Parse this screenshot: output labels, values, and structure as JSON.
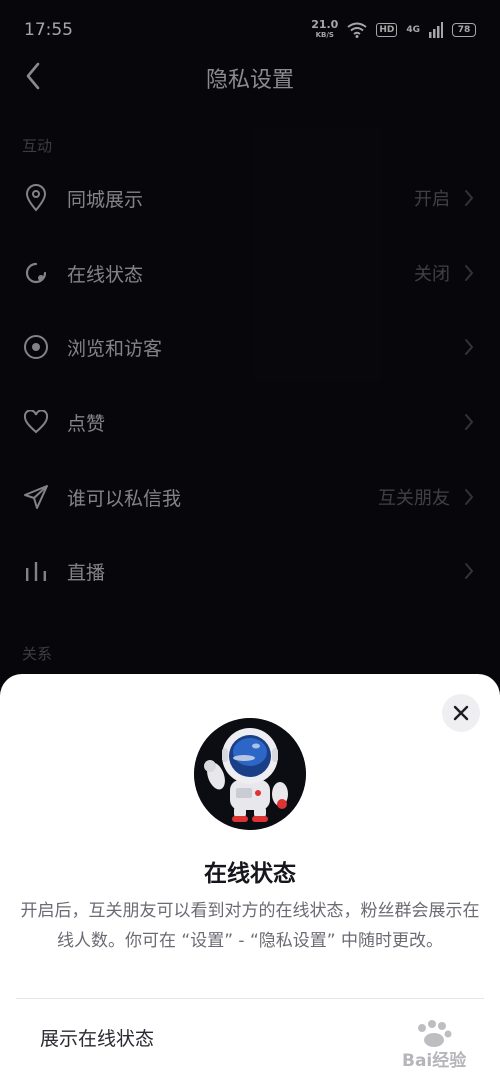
{
  "status_bar": {
    "time": "17:55",
    "speed_value": "21.0",
    "speed_unit": "KB/S",
    "hd": "HD",
    "signal": "4G",
    "battery": "78"
  },
  "nav": {
    "title": "隐私设置"
  },
  "sections": {
    "interaction": "互动",
    "relation": "关系"
  },
  "rows": [
    {
      "label": "同城展示",
      "value": "开启",
      "icon": "location-pin-icon"
    },
    {
      "label": "在线状态",
      "value": "关闭",
      "icon": "online-status-icon"
    },
    {
      "label": "浏览和访客",
      "value": "",
      "icon": "eye-icon"
    },
    {
      "label": "点赞",
      "value": "",
      "icon": "heart-icon"
    },
    {
      "label": "谁可以私信我",
      "value": "互关朋友",
      "icon": "paper-plane-icon"
    },
    {
      "label": "直播",
      "value": "",
      "icon": "bar-chart-icon"
    }
  ],
  "sheet": {
    "title": "在线状态",
    "description": "开启后，互关朋友可以看到对方的在线状态，粉丝群会展示在线人数。你可在 “设置” - “隐私设置” 中随时更改。",
    "option_label": "展示在线状态",
    "watermark_text": "Bai经验"
  },
  "colors": {
    "background": "#0b0b12",
    "sheet": "#ffffff"
  }
}
